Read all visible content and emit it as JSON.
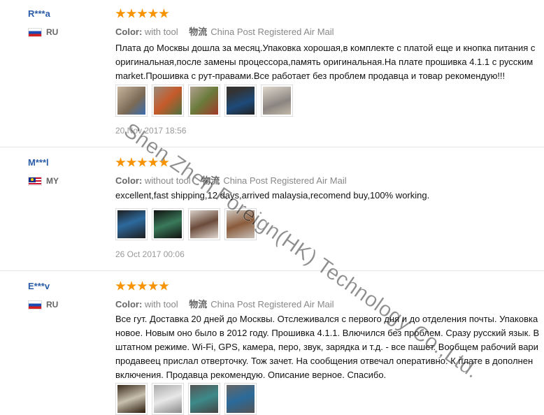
{
  "reviews": [
    {
      "user": "R***a",
      "country": "RU",
      "rating": 5,
      "color_label": "Color:",
      "color_value": "with tool",
      "shipping_label": "物流",
      "shipping_value": "China Post Registered Air Mail",
      "text_lines": [
        "Плата до Москвы дошла за месяц.Упаковка хорошая,в комплекте с платой еще и кнопка питания с",
        "оригинальная,после замены процессора,память оригинальная.На плате прошивка 4.1.1 с русским",
        "market.Прошивка с рут-правами.Все работает без проблем продавца и товар рекомендую!!!"
      ],
      "photo_count": 5,
      "date": "20 Nov 2017 18:56"
    },
    {
      "user": "M***l",
      "country": "MY",
      "rating": 5,
      "color_label": "Color:",
      "color_value": "without tool",
      "shipping_label": "物流",
      "shipping_value": "China Post Registered Air Mail",
      "text_lines": [
        "excellent,fast shipping,12 days,arrived malaysia,recomend buy,100% working."
      ],
      "photo_count": 4,
      "date": "26 Oct 2017 00:06"
    },
    {
      "user": "E***v",
      "country": "RU",
      "rating": 5,
      "color_label": "Color:",
      "color_value": "with tool",
      "shipping_label": "物流",
      "shipping_value": "China Post Registered Air Mail",
      "text_lines": [
        "Все гут. Доставка 20 дней до Москвы. Отслеживался с первого дня и до отделения почты. Упаковка",
        "новое. Новым оно было в 2012 году. Прошивка 4.1.1. Влючился без проблем. Сразу русский язык. В",
        "штатном режиме. Wi-Fi, GPS, камера, перо, звук, зарядка и т.д. - все пашет. Вообщем рабочий вари",
        "продавеец прислал отверточку. Тож зачет. На сообщения отвечал оперативно. К плате в дополнен",
        "включения. Продавца рекомендую. Описание верное. Спасибо."
      ],
      "photo_count": 4
    }
  ],
  "watermark": "Shen Zhen Foreign(HK) Technology Co.,Ltd.",
  "colors": {
    "username": "#2a5ca8",
    "star": "#f79300"
  }
}
